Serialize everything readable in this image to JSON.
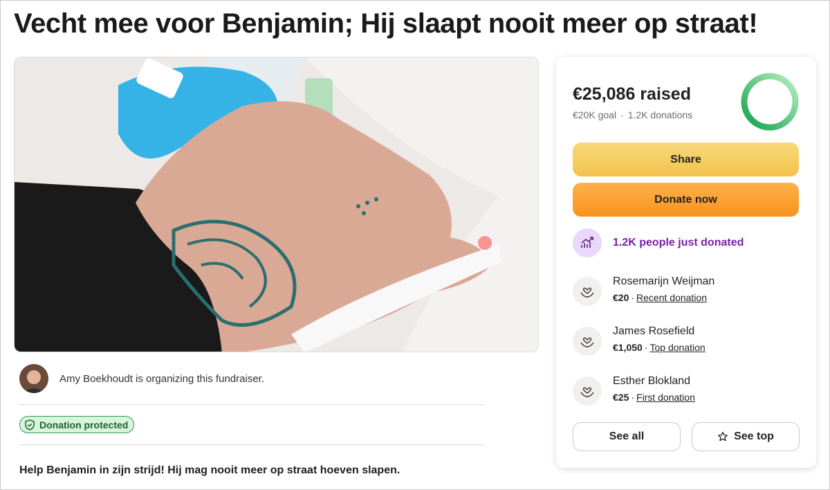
{
  "page": {
    "title": "Vecht mee voor Benjamin; Hij slaapt nooit meer op straat!"
  },
  "organizer": {
    "text": "Amy Boekhoudt is organizing this fundraiser."
  },
  "badge": {
    "label": "Donation protected"
  },
  "story": {
    "heading": "Help Benjamin in zijn strijd! Hij mag nooit meer op straat hoeven slapen."
  },
  "donation_card": {
    "raised": "€25,086 raised",
    "goal": "€20K goal",
    "donations": "1.2K donations",
    "progress_fraction": 1.0,
    "share_label": "Share",
    "donate_label": "Donate now",
    "trend_text": "1.2K people just donated",
    "donors": [
      {
        "name": "Rosemarijn Weijman",
        "amount": "€20",
        "type": "Recent donation"
      },
      {
        "name": "James Rosefield",
        "amount": "€1,050",
        "type": "Top donation"
      },
      {
        "name": "Esther Blokland",
        "amount": "€25",
        "type": "First donation"
      }
    ],
    "see_all_label": "See all",
    "see_top_label": "See top"
  },
  "icons": {
    "badge": "shield-check-icon",
    "trend": "trending-up-icon",
    "donor": "heart-hands-icon",
    "see_top": "star-icon"
  },
  "colors": {
    "accent_green": "#1ea64a",
    "share_yellow": "#f2c24c",
    "donate_orange": "#f7931e",
    "trend_purple": "#7a1fa8"
  }
}
